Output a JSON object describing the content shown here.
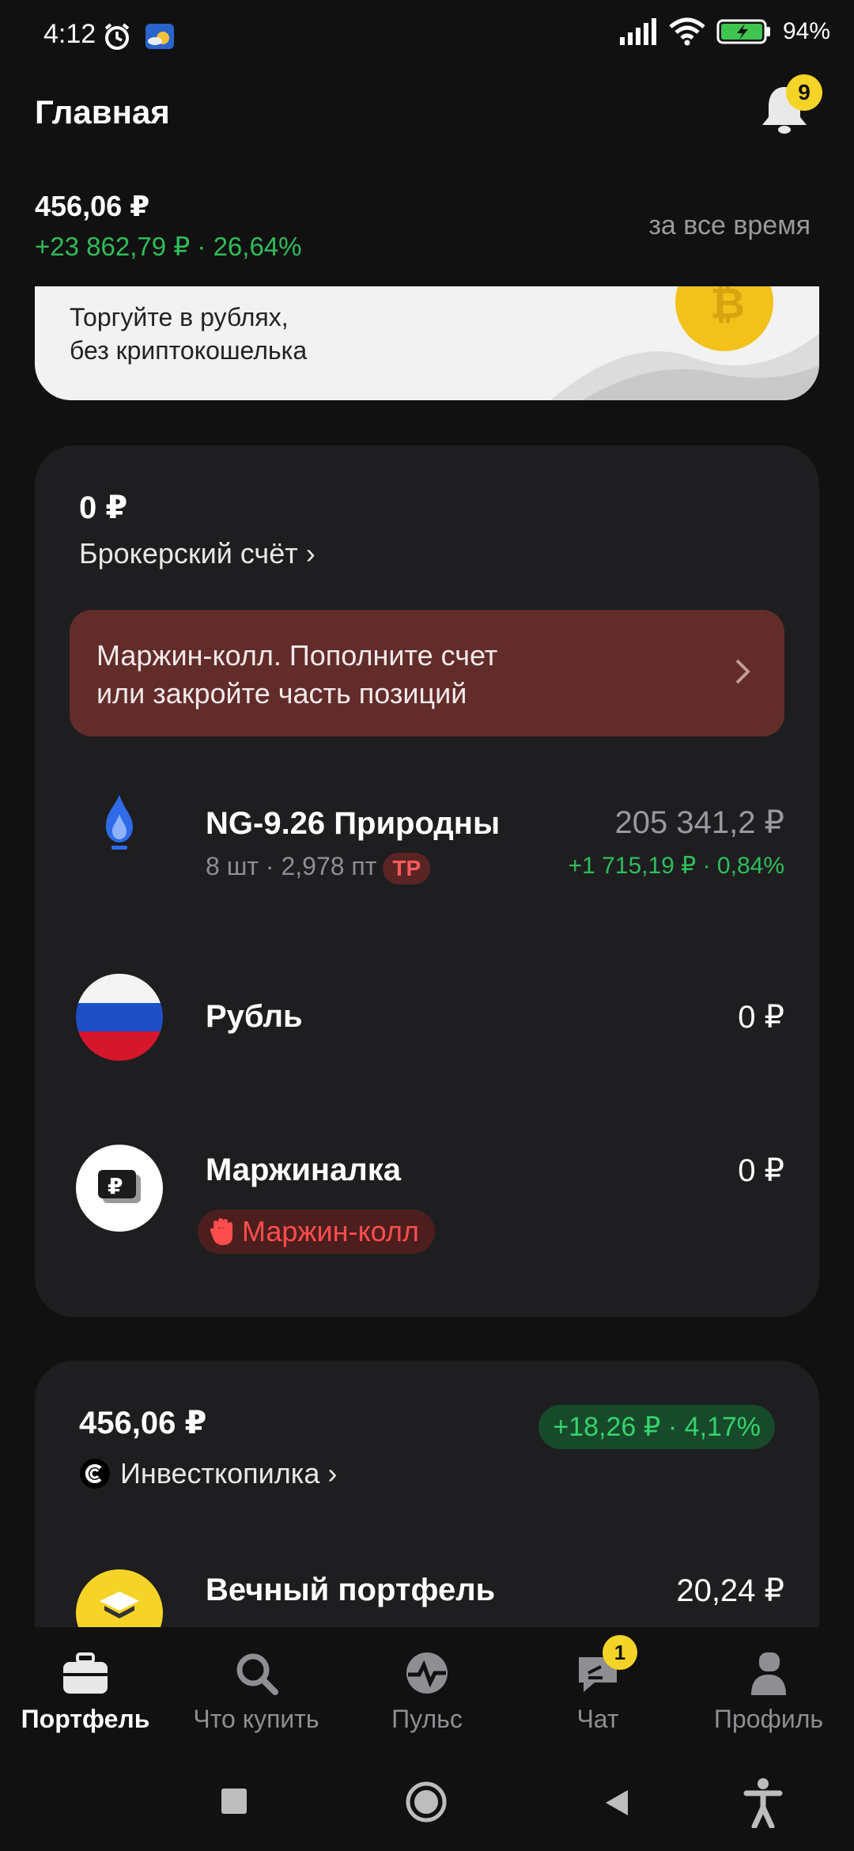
{
  "status_bar": {
    "time": "4:12",
    "battery": "94%"
  },
  "header": {
    "title": "Главная",
    "notifications_count": "9"
  },
  "summary": {
    "total": "456,06 ₽",
    "change": "+23 862,79 ₽ · 26,64%",
    "period": "за все время"
  },
  "banner": {
    "line1": "Торгуйте в рублях,",
    "line2": "без криптокошелька"
  },
  "broker": {
    "value": "0 ₽",
    "link": "Брокерский счёт ›",
    "alert_line1": "Маржин-колл. Пополните счет",
    "alert_line2": "или закройте часть позиций",
    "positions": [
      {
        "name": "NG-9.26 Природны",
        "sub": "8 шт · 2,978 пт",
        "tag": "TP",
        "value": "205 341,2 ₽",
        "change": "+1 715,19 ₽ · 0,84%"
      },
      {
        "name": "Рубль",
        "value": "0 ₽"
      },
      {
        "name": "Маржиналка",
        "value": "0 ₽",
        "badge": "Маржин-колл"
      }
    ]
  },
  "invest": {
    "value": "456,06 ₽",
    "change": "+18,26 ₽ · 4,17%",
    "link": "Инвесткопилка ›",
    "item_name": "Вечный портфель",
    "item_value": "20,24 ₽"
  },
  "bottom_nav": {
    "items": [
      {
        "label": "Портфель",
        "icon": "briefcase-icon"
      },
      {
        "label": "Что купить",
        "icon": "search-icon"
      },
      {
        "label": "Пульс",
        "icon": "pulse-icon"
      },
      {
        "label": "Чат",
        "icon": "chat-icon",
        "badge": "1"
      },
      {
        "label": "Профиль",
        "icon": "profile-icon"
      }
    ]
  },
  "colors": {
    "positive": "#2fbd5a",
    "alert_bg": "#622c2b",
    "badge_yellow": "#f5d427",
    "card_bg": "#1e1e20"
  }
}
